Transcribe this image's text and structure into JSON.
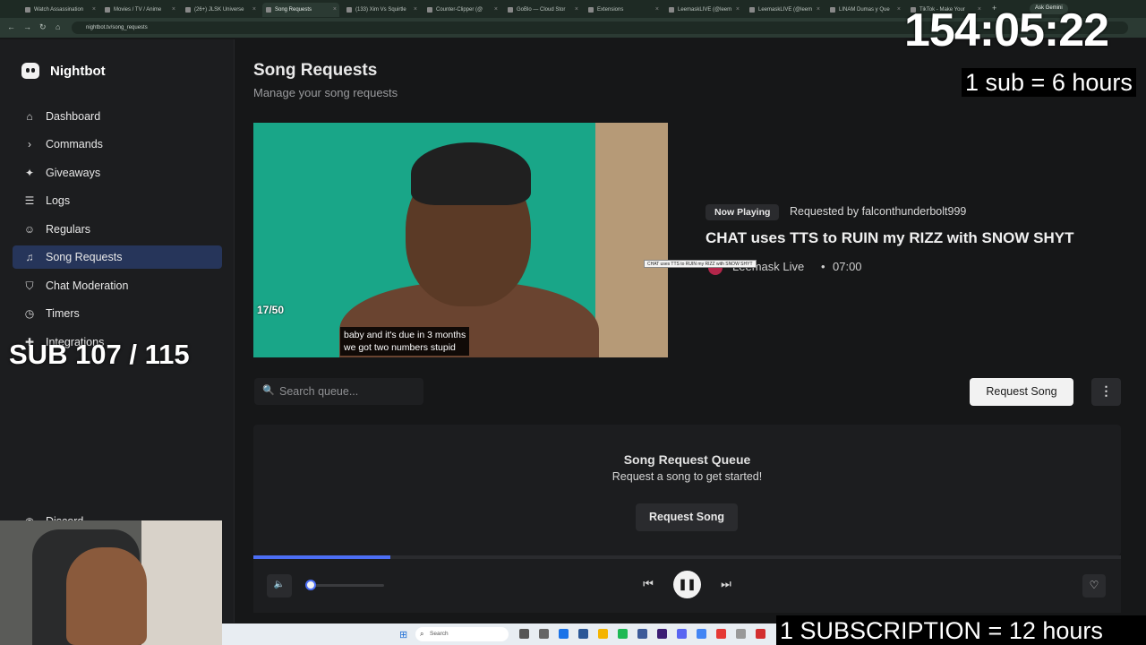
{
  "browser": {
    "tabs": [
      {
        "label": "Watch Assassination",
        "active": false
      },
      {
        "label": "Movies / TV / Anime",
        "active": false
      },
      {
        "label": "(26+) JLSK Universe",
        "active": false
      },
      {
        "label": "Song Requests",
        "active": true
      },
      {
        "label": "(133) Xim Vs Squirtle",
        "active": false
      },
      {
        "label": "Counter-Clipper (@",
        "active": false
      },
      {
        "label": "GoBlo — Cloud Stor",
        "active": false
      },
      {
        "label": "Extensions",
        "active": false
      },
      {
        "label": "LeemaskLIVE (@leem",
        "active": false
      },
      {
        "label": "LeemaskLIVE (@leem",
        "active": false
      },
      {
        "label": "LINAM Dumas y Que",
        "active": false
      },
      {
        "label": "TikTok - Make Your",
        "active": false
      }
    ],
    "new_tab_icon": "+",
    "ask_gemini_label": "Ask Gemini",
    "url": "nightbot.tv/song_requests"
  },
  "sidebar": {
    "brand": "Nightbot",
    "items": [
      {
        "label": "Dashboard",
        "icon": "home-icon",
        "glyph": "⌂",
        "active": false
      },
      {
        "label": "Commands",
        "icon": "terminal-icon",
        "glyph": "›",
        "active": false
      },
      {
        "label": "Giveaways",
        "icon": "gift-icon",
        "glyph": "✦",
        "active": false
      },
      {
        "label": "Logs",
        "icon": "list-icon",
        "glyph": "☰",
        "active": false
      },
      {
        "label": "Regulars",
        "icon": "users-icon",
        "glyph": "☺",
        "active": false
      },
      {
        "label": "Song Requests",
        "icon": "headphones-icon",
        "glyph": "♫",
        "active": true
      },
      {
        "label": "Chat Moderation",
        "icon": "shield-icon",
        "glyph": "⛉",
        "active": false
      },
      {
        "label": "Timers",
        "icon": "clock-icon",
        "glyph": "◷",
        "active": false
      },
      {
        "label": "Integrations",
        "icon": "puzzle-icon",
        "glyph": "✚",
        "active": false
      }
    ],
    "discord_label": "Discord"
  },
  "page": {
    "title": "Song Requests",
    "subtitle": "Manage your song requests"
  },
  "video": {
    "counter": "17/50",
    "subtitle_line1": "baby and it's due in 3 months",
    "subtitle_line2": "we got two numbers stupid"
  },
  "now_playing": {
    "badge": "Now Playing",
    "requested_by": "Requested by falconthunderbolt999",
    "title": "CHAT uses TTS to RUIN my RIZZ with SNOW SHYT",
    "channel": "Leemask Live",
    "separator": "•",
    "duration": "07:00",
    "tooltip": "CHAT uses TTS to RUIN my RIZZ with SNOW SHYT"
  },
  "queue": {
    "search_placeholder": "Search queue...",
    "request_button": "Request Song",
    "more_icon": "⋮",
    "title": "Song Request Queue",
    "empty_message": "Request a song to get started!",
    "empty_button": "Request Song"
  },
  "player": {
    "progress": 0.158,
    "volume": 0.06,
    "mute_icon": "🔈",
    "prev_icon": "⏮",
    "play_icon": "❚❚",
    "next_icon": "⏭",
    "fav_icon": "♡"
  },
  "overlays": {
    "timer": "154:05:22",
    "sub_hours": "1 sub = 6 hours",
    "sub_count": "SUB 107 / 115",
    "subscription_hours": "1 SUBSCRIPTION = 12 hours"
  },
  "taskbar": {
    "search_label": "Search"
  },
  "colors": {
    "accent": "#4c6ef5",
    "active_nav": "#26355a",
    "background": "#161718"
  }
}
